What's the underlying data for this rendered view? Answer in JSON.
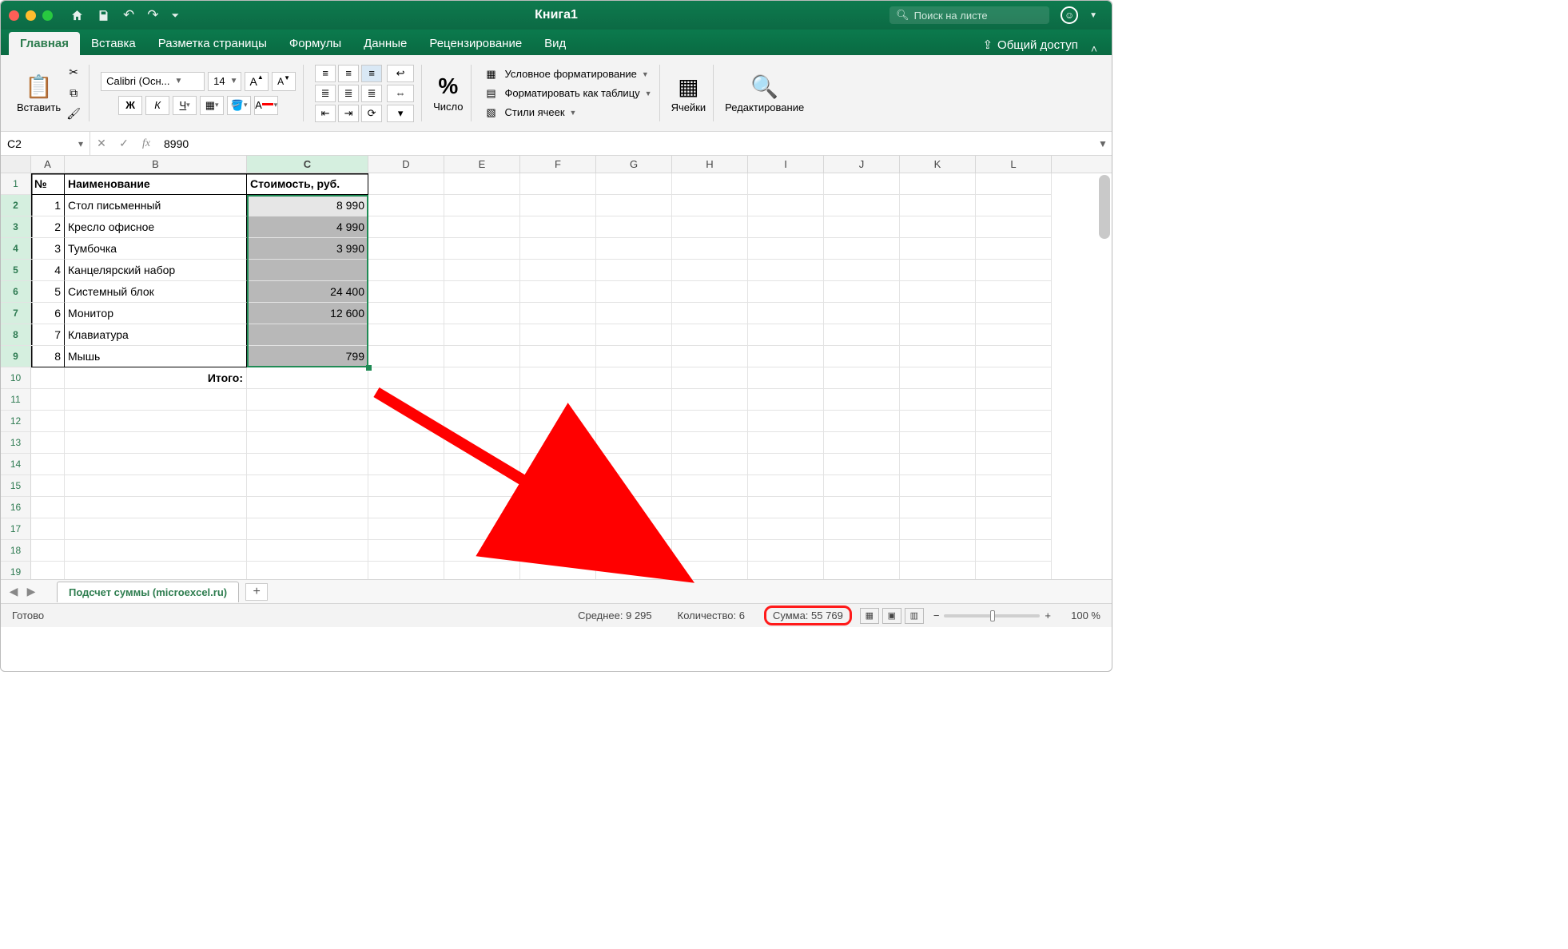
{
  "titlebar": {
    "title": "Книга1",
    "search_placeholder": "Поиск на листе"
  },
  "tabs": {
    "items": [
      "Главная",
      "Вставка",
      "Разметка страницы",
      "Формулы",
      "Данные",
      "Рецензирование",
      "Вид"
    ],
    "active_index": 0,
    "share": "Общий доступ"
  },
  "ribbon": {
    "paste": "Вставить",
    "font_name": "Calibri (Осн...",
    "font_size": "14",
    "bold": "Ж",
    "italic": "К",
    "underline": "Ч",
    "increase_font": "A▲",
    "decrease_font": "A▼",
    "number_label": "Число",
    "cond_format": "Условное форматирование",
    "format_table": "Форматировать как таблицу",
    "cell_styles": "Стили ячеек",
    "cells_label": "Ячейки",
    "editing_label": "Редактирование"
  },
  "formula_bar": {
    "cell_ref": "C2",
    "fx": "fx",
    "value": "8990"
  },
  "columns": [
    "A",
    "B",
    "C",
    "D",
    "E",
    "F",
    "G",
    "H",
    "I",
    "J",
    "K",
    "L"
  ],
  "row_numbers": [
    1,
    2,
    3,
    4,
    5,
    6,
    7,
    8,
    9,
    10,
    11,
    12,
    13,
    14,
    15,
    16,
    17,
    18,
    19
  ],
  "table": {
    "headers": {
      "num": "№",
      "name": "Наименование",
      "price": "Стоимость, руб."
    },
    "rows": [
      {
        "num": "1",
        "name": "Стол письменный",
        "price": "8 990"
      },
      {
        "num": "2",
        "name": "Кресло офисное",
        "price": "4 990"
      },
      {
        "num": "3",
        "name": "Тумбочка",
        "price": "3 990"
      },
      {
        "num": "4",
        "name": "Канцелярский набор",
        "price": ""
      },
      {
        "num": "5",
        "name": "Системный блок",
        "price": "24 400"
      },
      {
        "num": "6",
        "name": "Монитор",
        "price": "12 600"
      },
      {
        "num": "7",
        "name": "Клавиатура",
        "price": ""
      },
      {
        "num": "8",
        "name": "Мышь",
        "price": "799"
      }
    ],
    "total_label": "Итого:"
  },
  "sheet_tab": {
    "name": "Подсчет суммы (microexcel.ru)"
  },
  "status": {
    "ready": "Готово",
    "avg_label": "Среднее:",
    "avg_val": "9 295",
    "count_label": "Количество:",
    "count_val": "6",
    "sum_label": "Сумма:",
    "sum_val": "55 769",
    "zoom": "100 %"
  },
  "selected_col": "C",
  "selected_rows": [
    2,
    3,
    4,
    5,
    6,
    7,
    8,
    9
  ]
}
